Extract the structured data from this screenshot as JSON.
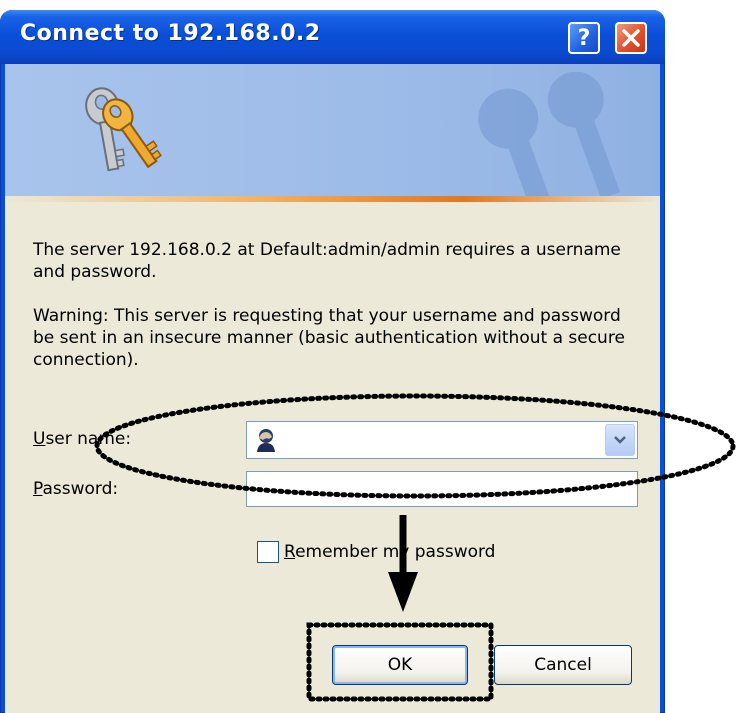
{
  "window": {
    "title": "Connect to 192.168.0.2"
  },
  "message": {
    "line1": "The server 192.168.0.2 at Default:admin/admin requires a username and password.",
    "warning": "Warning: This server is requesting that your username and password be sent in an insecure manner (basic authentication without a secure connection)."
  },
  "form": {
    "username_label_first": "U",
    "username_label_rest": "ser name:",
    "username_value": "",
    "password_label_first": "P",
    "password_label_rest": "assword:",
    "password_value": "",
    "remember_label_first": "R",
    "remember_label_rest": "emember my password",
    "remember_checked": false
  },
  "buttons": {
    "ok": "OK",
    "cancel": "Cancel"
  },
  "colors": {
    "titlebar": "#0a4fd8",
    "dialog_bg": "#ece9d8",
    "close_button": "#e2502c",
    "annotation": "#000000"
  },
  "icons": [
    "help-icon",
    "close-icon",
    "keys-icon",
    "user-icon",
    "dropdown-arrow-icon"
  ]
}
